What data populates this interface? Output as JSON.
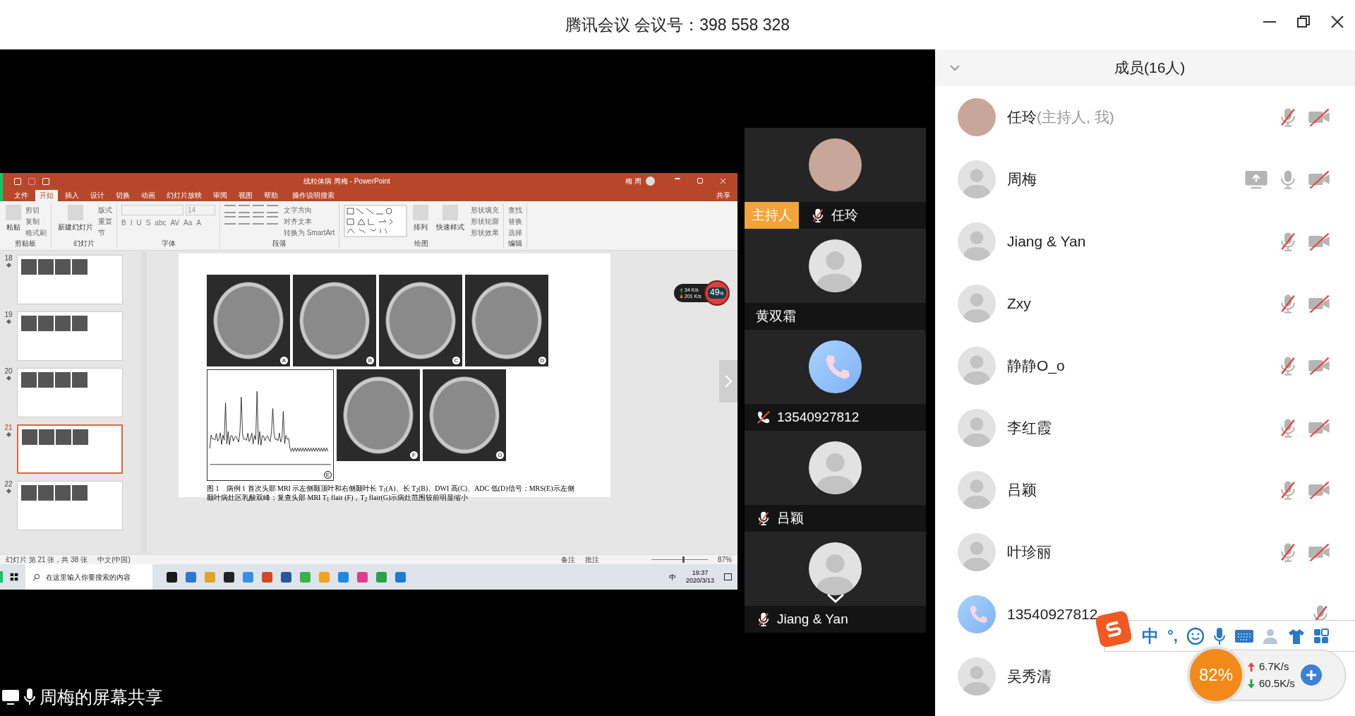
{
  "window": {
    "title": "腾讯会议 会议号：398 558 328"
  },
  "share": {
    "label": "周梅的屏幕共享",
    "ppt": {
      "title": "线粒体病 周梅 - PowerPoint",
      "user": "梅 周",
      "share_button": "共享",
      "tabs": [
        {
          "label": "文件",
          "selected": false
        },
        {
          "label": "开始",
          "selected": true
        },
        {
          "label": "插入",
          "selected": false
        },
        {
          "label": "设计",
          "selected": false
        },
        {
          "label": "切换",
          "selected": false
        },
        {
          "label": "动画",
          "selected": false
        },
        {
          "label": "幻灯片放映",
          "selected": false
        },
        {
          "label": "审阅",
          "selected": false
        },
        {
          "label": "视图",
          "selected": false
        },
        {
          "label": "帮助",
          "selected": false
        }
      ],
      "tell_me": "操作说明搜索",
      "ribbon_groups": [
        {
          "kind": "basic",
          "label": "剪贴板",
          "big": [
            "粘贴"
          ],
          "items": [
            "剪切",
            "复制",
            "格式刷"
          ]
        },
        {
          "kind": "basic",
          "label": "幻灯片",
          "big": [
            "新建幻灯片"
          ],
          "items": [
            "版式",
            "重置",
            "节"
          ]
        },
        {
          "kind": "font",
          "label": "字体",
          "size": "14",
          "items": [
            "B",
            "I",
            "U",
            "S",
            "abc",
            "AV",
            "Aa",
            "A"
          ]
        },
        {
          "kind": "paragraph",
          "label": "段落",
          "items": [
            "文字方向",
            "对齐文本",
            "转换为 SmartArt"
          ]
        },
        {
          "kind": "drawing",
          "label": "绘图",
          "big": [
            "排列",
            "快速样式"
          ],
          "items": [
            "形状填充",
            "形状轮廓",
            "形状效果"
          ]
        },
        {
          "kind": "basic",
          "label": "编辑",
          "items": [
            "查找",
            "替换",
            "选择"
          ]
        }
      ],
      "slides": [
        {
          "number": "18",
          "selected": false
        },
        {
          "number": "19",
          "selected": false
        },
        {
          "number": "20",
          "selected": false
        },
        {
          "number": "21",
          "selected": true
        },
        {
          "number": "22",
          "selected": false
        }
      ],
      "figure_letters": [
        "A",
        "B",
        "C",
        "D",
        "E",
        "F",
        "G"
      ],
      "caption": "图 1　病例 1 首次头部 MRI 示左侧颞顶叶和右侧颞叶长 T$_{1}$(A)、长 T$_{2}$(B)、DWI 高(C)、ADC 低(D)信号；MRS(E)示左侧颞叶病灶区乳酸双峰；复查头部 MRI T$_{1}$ flair (F)，T$_{2}$ flair(G)示病灶范围较前明显缩小",
      "status": {
        "slide": "幻灯片 第 21 张，共 38 张",
        "language": "中文(中国)",
        "notes": "备注",
        "comments": "批注",
        "zoom": "87%",
        "zoom_slider": {
          "level": 0.55
        }
      },
      "taskbar": {
        "search_placeholder": "在这里输入你要搜索的内容",
        "time": "19:37",
        "date": "2020/3/13",
        "ime": "中"
      },
      "speed_widget": {
        "percent": "49",
        "unit": "%",
        "up": "34 K/s",
        "down": "201 K/s"
      }
    }
  },
  "video_tiles": [
    {
      "name": "任玲",
      "kind": "photo",
      "host_badge": "主持人",
      "mic_muted": true
    },
    {
      "name": "黄双霜",
      "kind": "default",
      "mic_muted": false
    },
    {
      "name": "13540927812",
      "kind": "phone",
      "mic_muted": true
    },
    {
      "name": "吕颖",
      "kind": "default",
      "mic_muted": true
    },
    {
      "name": "Jiang & Yan",
      "kind": "default",
      "mic_muted": true
    }
  ],
  "members": {
    "title": "成员(16人)",
    "items": [
      {
        "name": "任玲",
        "note": "(主持人, 我)",
        "kind": "photo",
        "sharing": false,
        "mic_muted": true,
        "camera_off": true
      },
      {
        "name": "周梅",
        "kind": "default",
        "sharing": true,
        "mic_muted": false,
        "camera_off": true
      },
      {
        "name": "Jiang & Yan",
        "kind": "default",
        "sharing": false,
        "mic_muted": true,
        "camera_off": true
      },
      {
        "name": "Zxy",
        "kind": "default",
        "sharing": false,
        "mic_muted": true,
        "camera_off": true
      },
      {
        "name": "静静O_o",
        "kind": "default",
        "sharing": false,
        "mic_muted": true,
        "camera_off": true
      },
      {
        "name": "李红霞",
        "kind": "default",
        "sharing": false,
        "mic_muted": true,
        "camera_off": true
      },
      {
        "name": "吕颖",
        "kind": "default",
        "sharing": false,
        "mic_muted": true,
        "camera_off": true
      },
      {
        "name": "叶珍丽",
        "kind": "default",
        "sharing": false,
        "mic_muted": true,
        "camera_off": true
      },
      {
        "name": "13540927812",
        "kind": "phone",
        "sharing": false,
        "mic_muted": true
      },
      {
        "name": "吴秀清",
        "kind": "default",
        "sharing": false
      }
    ]
  },
  "ime_bar": {
    "mode": "中",
    "punctuation": "°,"
  },
  "net_widget": {
    "percent": "82%",
    "up": "6.7K/s",
    "down": "60.5K/s"
  }
}
